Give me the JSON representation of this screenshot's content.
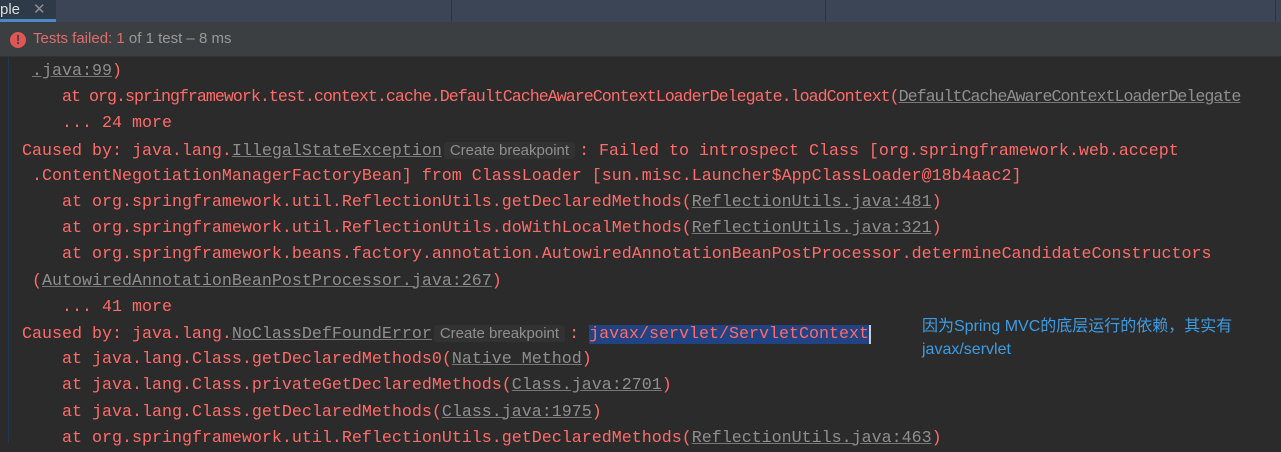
{
  "tab": {
    "label": "ple",
    "close": "✕"
  },
  "status": {
    "icon": "error-icon",
    "failed_label": "Tests failed:",
    "failed_count": "1",
    "rest": " of 1 test – 8 ms"
  },
  "lines": [
    {
      "indent": 1,
      "segs": [
        {
          "t": "link",
          "v": ".java:99"
        },
        {
          "t": "red",
          "v": ")"
        }
      ]
    },
    {
      "indent": 4,
      "segs": [
        {
          "t": "red",
          "v": "at org.springframework.test.context.cache.DefaultCacheAwareContextLoaderDelegate.loadContext("
        },
        {
          "t": "link",
          "v": "DefaultCacheAwareContextLoaderDelegate"
        }
      ]
    },
    {
      "indent": 4,
      "segs": [
        {
          "t": "red",
          "v": "... 24 more"
        }
      ]
    },
    {
      "indent": 0,
      "segs": [
        {
          "t": "red",
          "v": "Caused by: java.lang."
        },
        {
          "t": "link",
          "v": "IllegalStateException"
        },
        {
          "t": "chip",
          "v": "Create breakpoint"
        },
        {
          "t": "red",
          "v": ": Failed to introspect Class [org.springframework.web.accept"
        }
      ]
    },
    {
      "indent": 1,
      "segs": [
        {
          "t": "red",
          "v": ".ContentNegotiationManagerFactoryBean] from ClassLoader [sun.misc.Launcher$AppClassLoader@18b4aac2]"
        }
      ]
    },
    {
      "indent": 4,
      "segs": [
        {
          "t": "red",
          "v": "at org.springframework.util.ReflectionUtils.getDeclaredMethods("
        },
        {
          "t": "link",
          "v": "ReflectionUtils.java:481"
        },
        {
          "t": "red",
          "v": ")"
        }
      ]
    },
    {
      "indent": 4,
      "segs": [
        {
          "t": "red",
          "v": "at org.springframework.util.ReflectionUtils.doWithLocalMethods("
        },
        {
          "t": "link",
          "v": "ReflectionUtils.java:321"
        },
        {
          "t": "red",
          "v": ")"
        }
      ]
    },
    {
      "indent": 4,
      "segs": [
        {
          "t": "red",
          "v": "at org.springframework.beans.factory.annotation.AutowiredAnnotationBeanPostProcessor.determineCandidateConstructors"
        }
      ]
    },
    {
      "indent": 1,
      "segs": [
        {
          "t": "red",
          "v": "("
        },
        {
          "t": "link",
          "v": "AutowiredAnnotationBeanPostProcessor.java:267"
        },
        {
          "t": "red",
          "v": ")"
        }
      ]
    },
    {
      "indent": 4,
      "segs": [
        {
          "t": "red",
          "v": "... 41 more"
        }
      ]
    },
    {
      "indent": 0,
      "segs": [
        {
          "t": "red",
          "v": "Caused by: java.lang."
        },
        {
          "t": "link",
          "v": "NoClassDefFoundError"
        },
        {
          "t": "chip",
          "v": "Create breakpoint"
        },
        {
          "t": "red",
          "v": ": "
        },
        {
          "t": "sel",
          "v": "javax/servlet/ServletContext"
        }
      ]
    },
    {
      "indent": 4,
      "segs": [
        {
          "t": "red",
          "v": "at java.lang.Class.getDeclaredMethods0("
        },
        {
          "t": "link",
          "v": "Native Method"
        },
        {
          "t": "red",
          "v": ")"
        }
      ]
    },
    {
      "indent": 4,
      "segs": [
        {
          "t": "red",
          "v": "at java.lang.Class.privateGetDeclaredMethods("
        },
        {
          "t": "link",
          "v": "Class.java:2701"
        },
        {
          "t": "red",
          "v": ")"
        }
      ]
    },
    {
      "indent": 4,
      "segs": [
        {
          "t": "red",
          "v": "at java.lang.Class.getDeclaredMethods("
        },
        {
          "t": "link",
          "v": "Class.java:1975"
        },
        {
          "t": "red",
          "v": ")"
        }
      ]
    },
    {
      "indent": 4,
      "segs": [
        {
          "t": "red",
          "v": "at org.springframework.util.ReflectionUtils.getDeclaredMethods("
        },
        {
          "t": "link",
          "v": "ReflectionUtils.java:463"
        },
        {
          "t": "red",
          "v": ")"
        }
      ]
    }
  ],
  "note": "因为Spring MVC的底层运行的依赖，其实有\njavax/servlet"
}
